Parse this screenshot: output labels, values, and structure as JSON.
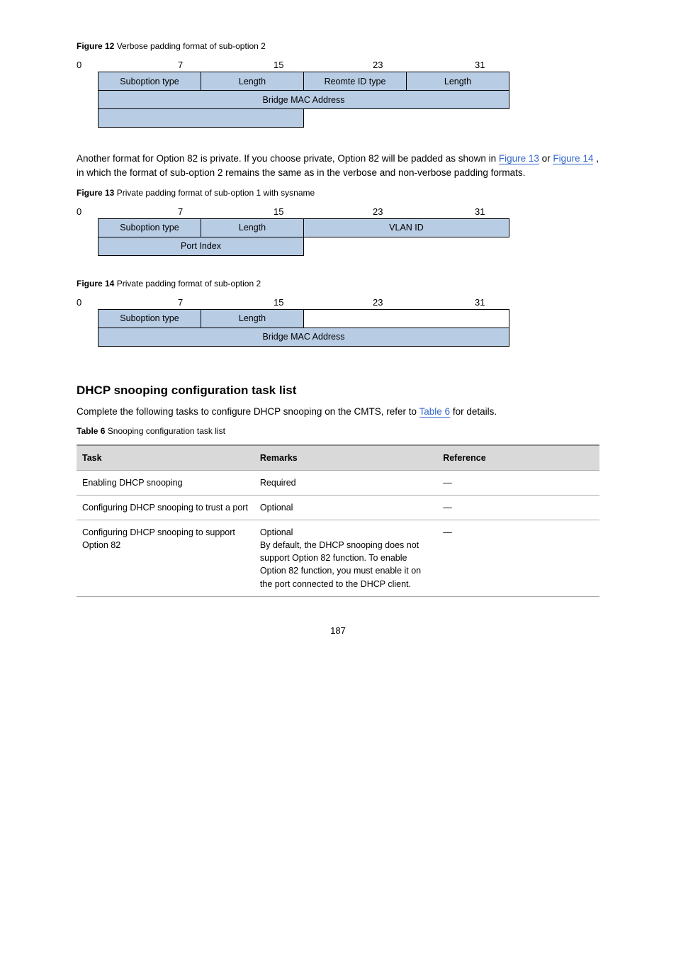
{
  "figure12": {
    "caption_bold": "Figure 12",
    "caption_rest": " Verbose padding format of sub-option 2",
    "bits": {
      "b0": "0",
      "b7": "7",
      "b15": "15",
      "b23": "23",
      "b31": "31"
    },
    "cells": {
      "suboption": "Suboption type",
      "length1": "Length",
      "remote_id_type": "Reomte ID type",
      "length2": "Length",
      "bridge_mac": "Bridge MAC Address"
    }
  },
  "para_after_f12": {
    "pre": "Another format for Option 82 is private. If you choose private, Option 82 will be padded as shown in ",
    "link1": "Figure 13",
    "mid": " or ",
    "link2": "Figure 14",
    "post": ", in which the format of sub-option 2 remains the same as in the verbose and non-verbose padding formats."
  },
  "figure13": {
    "caption_bold": "Figure 13",
    "caption_rest": " Private padding format of sub-option 1 with sysname",
    "bits": {
      "b0": "0",
      "b7": "7",
      "b15": "15",
      "b23": "23",
      "b31": "31"
    },
    "cells": {
      "suboption": "Suboption type",
      "length": "Length",
      "vlanid": "VLAN ID",
      "portindex": "Port Index"
    }
  },
  "figure14": {
    "caption_bold": "Figure 14",
    "caption_rest": " Private padding format of sub-option 2",
    "bits": {
      "b0": "0",
      "b7": "7",
      "b15": "15",
      "b23": "23",
      "b31": "31"
    },
    "cells": {
      "suboption": "Suboption type",
      "length": "Length",
      "bridge_mac": "Bridge MAC Address"
    }
  },
  "section_title": "DHCP snooping configuration task list",
  "section_para": {
    "pre": "Complete the following tasks to configure DHCP snooping on the CMTS, refer to ",
    "link": "Table 6",
    "post": " for details."
  },
  "table6": {
    "caption_bold": "Table 6",
    "caption_rest": " Snooping configuration task list",
    "headers": {
      "task": "Task",
      "remarks": "Remarks",
      "reference": "Reference"
    },
    "rows": [
      {
        "task": "Enabling DHCP snooping",
        "remarks": "Required",
        "reference": "—"
      },
      {
        "task": "Configuring DHCP snooping to trust a port",
        "remarks": "Optional",
        "reference": "—"
      },
      {
        "task": "Configuring DHCP snooping to support Option 82",
        "remarks": "Optional\nBy default, the DHCP snooping does not support Option 82 function. To enable Option 82 function, you must enable it on the port connected to the DHCP client.",
        "reference": "—"
      }
    ]
  },
  "page_number": "187"
}
